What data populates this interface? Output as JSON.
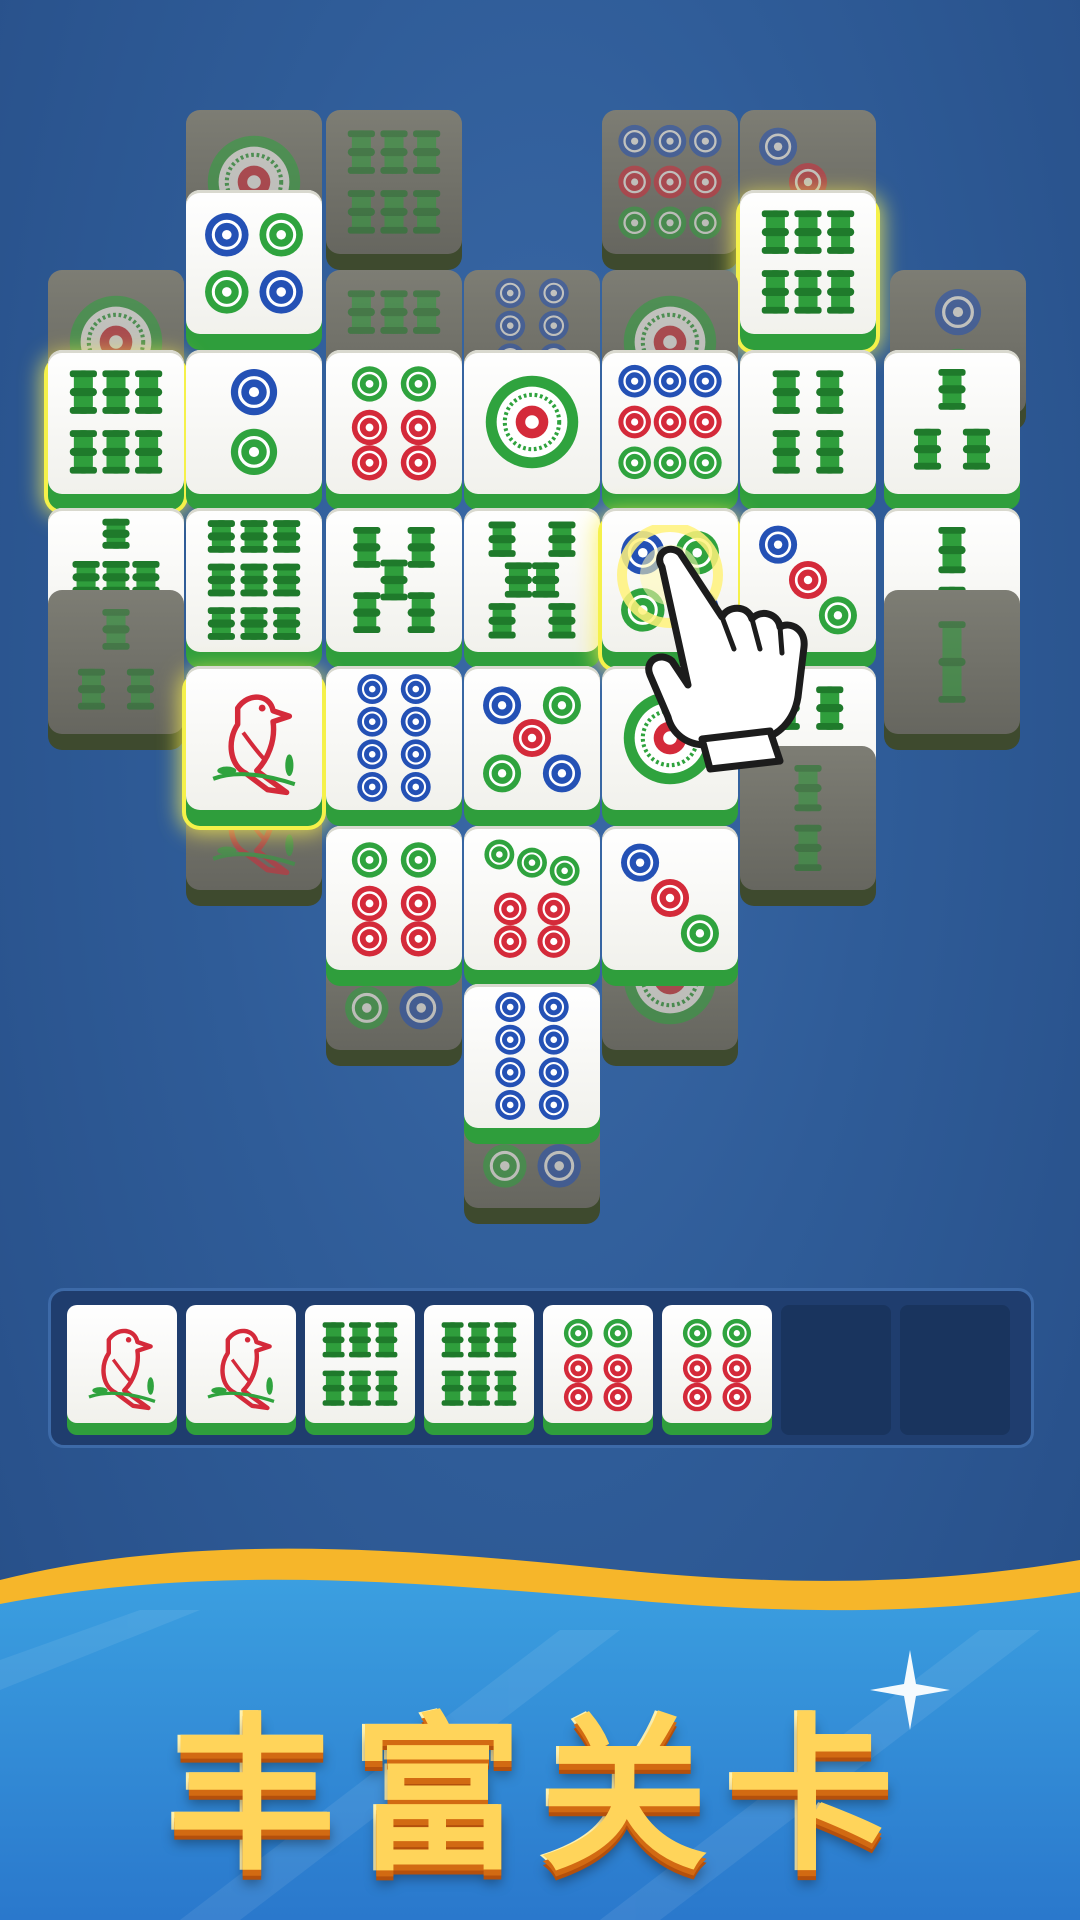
{
  "banner": {
    "title": "丰富关卡"
  },
  "colors": {
    "bamboo": "#2f9e3c",
    "dot_red": "#d42a3a",
    "dot_blue": "#2451b5",
    "dot_green": "#2fa33e",
    "glow": "#f5f14a"
  },
  "board": {
    "tiles": [
      {
        "name": "tile-1-dot",
        "suit": "dot",
        "rank": 1,
        "blocked": true
      },
      {
        "name": "tile-6-bamboo",
        "suit": "bam",
        "rank": 6,
        "blocked": true
      },
      {
        "name": "tile-9-dot",
        "suit": "dot",
        "rank": 9,
        "blocked": true
      },
      {
        "name": "tile-3-dot",
        "suit": "dot",
        "rank": 3,
        "blocked": true
      },
      {
        "name": "tile-4-dot",
        "suit": "dot",
        "rank": 4
      },
      {
        "name": "tile-6-bamboo",
        "suit": "bam",
        "rank": 6,
        "glow": true
      },
      {
        "name": "tile-1-dot",
        "suit": "dot",
        "rank": 1,
        "blocked": true
      },
      {
        "name": "tile-6-bamboo",
        "suit": "bam",
        "rank": 6,
        "blocked": true
      },
      {
        "name": "tile-8-dot",
        "suit": "dot",
        "rank": 8,
        "blocked": true
      },
      {
        "name": "tile-1-dot",
        "suit": "dot",
        "rank": 1,
        "blocked": true
      },
      {
        "name": "tile-2-dot",
        "suit": "dot",
        "rank": 2,
        "blocked": true
      },
      {
        "name": "tile-6-bamboo",
        "suit": "bam",
        "rank": 6,
        "glow": true
      },
      {
        "name": "tile-2-dot",
        "suit": "dot",
        "rank": 2
      },
      {
        "name": "tile-6-dot",
        "suit": "dot",
        "rank": 6
      },
      {
        "name": "tile-1-dot",
        "suit": "dot",
        "rank": 1
      },
      {
        "name": "tile-9-dot",
        "suit": "dot",
        "rank": 9
      },
      {
        "name": "tile-4-bamboo",
        "suit": "bam",
        "rank": 4
      },
      {
        "name": "tile-3-bamboo",
        "suit": "bam",
        "rank": 3
      },
      {
        "name": "tile-7-bamboo",
        "suit": "bam",
        "rank": 7
      },
      {
        "name": "tile-9-bamboo",
        "suit": "bam",
        "rank": 9
      },
      {
        "name": "tile-5-bamboo",
        "suit": "bam",
        "rank": 5
      },
      {
        "name": "tile-8-bamboo",
        "suit": "bam",
        "rank": 8
      },
      {
        "name": "tile-4-dot",
        "suit": "dot",
        "rank": 4,
        "glow": true
      },
      {
        "name": "tile-3-dot",
        "suit": "dot",
        "rank": 3
      },
      {
        "name": "tile-2-bamboo",
        "suit": "bam",
        "rank": 2
      },
      {
        "name": "tile-3-bamboo",
        "suit": "bam",
        "rank": 3,
        "blocked": true
      },
      {
        "name": "tile-bird",
        "suit": "bird",
        "rank": 1,
        "blocked": true
      },
      {
        "name": "tile-1-bamboo",
        "suit": "bam",
        "rank": 1,
        "blocked": true
      },
      {
        "name": "tile-bird",
        "suit": "bird",
        "rank": 1,
        "glow": true
      },
      {
        "name": "tile-8-dot",
        "suit": "dot",
        "rank": 8
      },
      {
        "name": "tile-5-dot",
        "suit": "dot",
        "rank": 5
      },
      {
        "name": "tile-1-dot",
        "suit": "dot",
        "rank": 1
      },
      {
        "name": "tile-4-bamboo",
        "suit": "bam",
        "rank": 4
      },
      {
        "name": "tile-2-bamboo",
        "suit": "bam",
        "rank": 2,
        "blocked": true
      },
      {
        "name": "tile-4-dot",
        "suit": "dot",
        "rank": 4,
        "blocked": true
      },
      {
        "name": "tile-1-dot",
        "suit": "dot",
        "rank": 1,
        "blocked": true
      },
      {
        "name": "tile-6-dot",
        "suit": "dot",
        "rank": 6
      },
      {
        "name": "tile-7-dot",
        "suit": "dot",
        "rank": 7
      },
      {
        "name": "tile-3-dot",
        "suit": "dot",
        "rank": 3
      },
      {
        "name": "tile-4-dot",
        "suit": "dot",
        "rank": 4,
        "blocked": true
      },
      {
        "name": "tile-8-dot",
        "suit": "dot",
        "rank": 8
      }
    ]
  },
  "tray": {
    "capacity": 8,
    "slots": [
      {
        "name": "tray-tile-bird",
        "suit": "bird",
        "rank": 1
      },
      {
        "name": "tray-tile-bird",
        "suit": "bird",
        "rank": 1
      },
      {
        "name": "tray-tile-6-bamboo",
        "suit": "bam",
        "rank": 6
      },
      {
        "name": "tray-tile-6-bamboo",
        "suit": "bam",
        "rank": 6
      },
      {
        "name": "tray-tile-6-dot",
        "suit": "dot",
        "rank": 6
      },
      {
        "name": "tray-tile-6-dot",
        "suit": "dot",
        "rank": 6
      }
    ]
  },
  "hint": {
    "icon": "pointing-hand-icon"
  }
}
